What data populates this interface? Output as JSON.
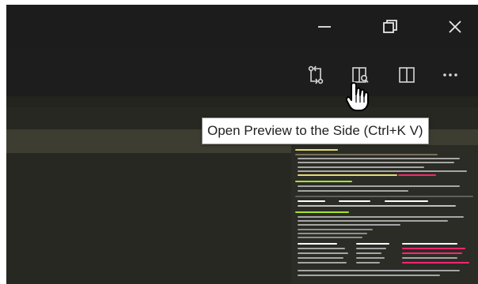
{
  "window_controls": {
    "minimize_icon": "minimize-icon",
    "restore_icon": "restore-icon",
    "close_icon": "close-icon"
  },
  "editor_actions": [
    {
      "icon": "git-compare-icon",
      "name": "compare-changes"
    },
    {
      "icon": "open-preview-side-icon",
      "name": "open-preview-side"
    },
    {
      "icon": "split-editor-icon",
      "name": "split-editor"
    },
    {
      "icon": "more-actions-icon",
      "name": "more-actions"
    }
  ],
  "tooltip": {
    "text": "Open Preview to the Side (Ctrl+K V)"
  },
  "colors": {
    "titlebar": "#1c1c1c",
    "editor_background": "#272822",
    "line_highlight": "#3e3d32",
    "icon": "#e7e7e7"
  }
}
